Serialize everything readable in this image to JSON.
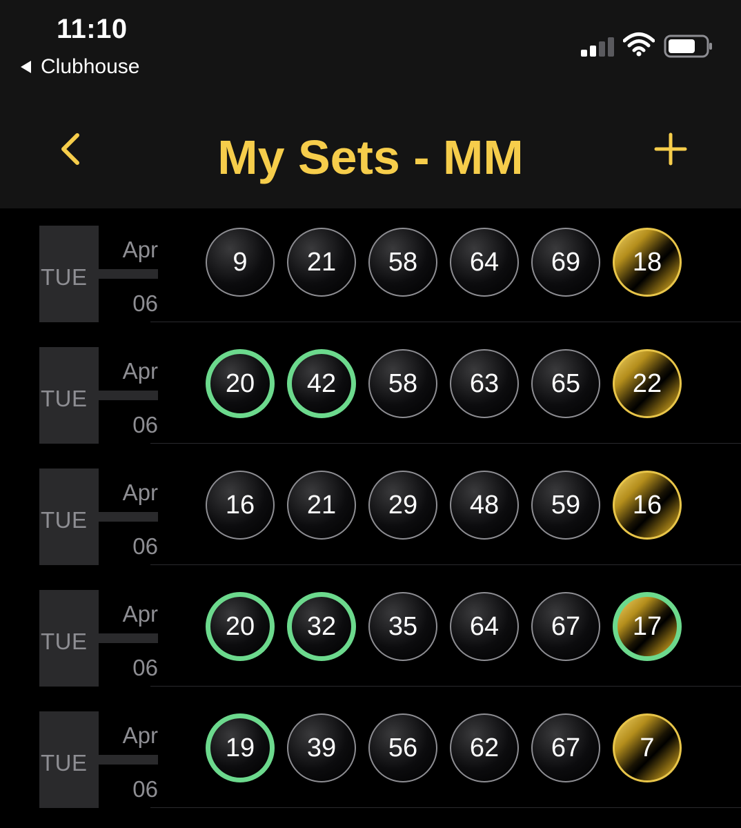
{
  "status_bar": {
    "time": "11:10",
    "back_app": "Clubhouse",
    "signal_icon": "cellular-signal-icon",
    "wifi_icon": "wifi-icon",
    "battery_icon": "battery-icon"
  },
  "nav": {
    "title": "My Sets - MM",
    "back_icon": "chevron-left-icon",
    "add_icon": "plus-icon"
  },
  "colors": {
    "accent": "#f6cd4b",
    "match": "#6cd98d",
    "muted": "#8e8e93"
  },
  "sets": [
    {
      "day": "TUE",
      "month": "Apr",
      "date": "06",
      "balls": [
        {
          "value": "9",
          "matched": false
        },
        {
          "value": "21",
          "matched": false
        },
        {
          "value": "58",
          "matched": false
        },
        {
          "value": "64",
          "matched": false
        },
        {
          "value": "69",
          "matched": false
        },
        {
          "value": "18",
          "matched": false,
          "mega": true
        }
      ]
    },
    {
      "day": "TUE",
      "month": "Apr",
      "date": "06",
      "balls": [
        {
          "value": "20",
          "matched": true
        },
        {
          "value": "42",
          "matched": true
        },
        {
          "value": "58",
          "matched": false
        },
        {
          "value": "63",
          "matched": false
        },
        {
          "value": "65",
          "matched": false
        },
        {
          "value": "22",
          "matched": false,
          "mega": true
        }
      ]
    },
    {
      "day": "TUE",
      "month": "Apr",
      "date": "06",
      "balls": [
        {
          "value": "16",
          "matched": false
        },
        {
          "value": "21",
          "matched": false
        },
        {
          "value": "29",
          "matched": false
        },
        {
          "value": "48",
          "matched": false
        },
        {
          "value": "59",
          "matched": false
        },
        {
          "value": "16",
          "matched": false,
          "mega": true
        }
      ]
    },
    {
      "day": "TUE",
      "month": "Apr",
      "date": "06",
      "balls": [
        {
          "value": "20",
          "matched": true
        },
        {
          "value": "32",
          "matched": true
        },
        {
          "value": "35",
          "matched": false
        },
        {
          "value": "64",
          "matched": false
        },
        {
          "value": "67",
          "matched": false
        },
        {
          "value": "17",
          "matched": true,
          "mega": true
        }
      ]
    },
    {
      "day": "TUE",
      "month": "Apr",
      "date": "06",
      "balls": [
        {
          "value": "19",
          "matched": true
        },
        {
          "value": "39",
          "matched": false
        },
        {
          "value": "56",
          "matched": false
        },
        {
          "value": "62",
          "matched": false
        },
        {
          "value": "67",
          "matched": false
        },
        {
          "value": "7",
          "matched": false,
          "mega": true
        }
      ]
    }
  ]
}
